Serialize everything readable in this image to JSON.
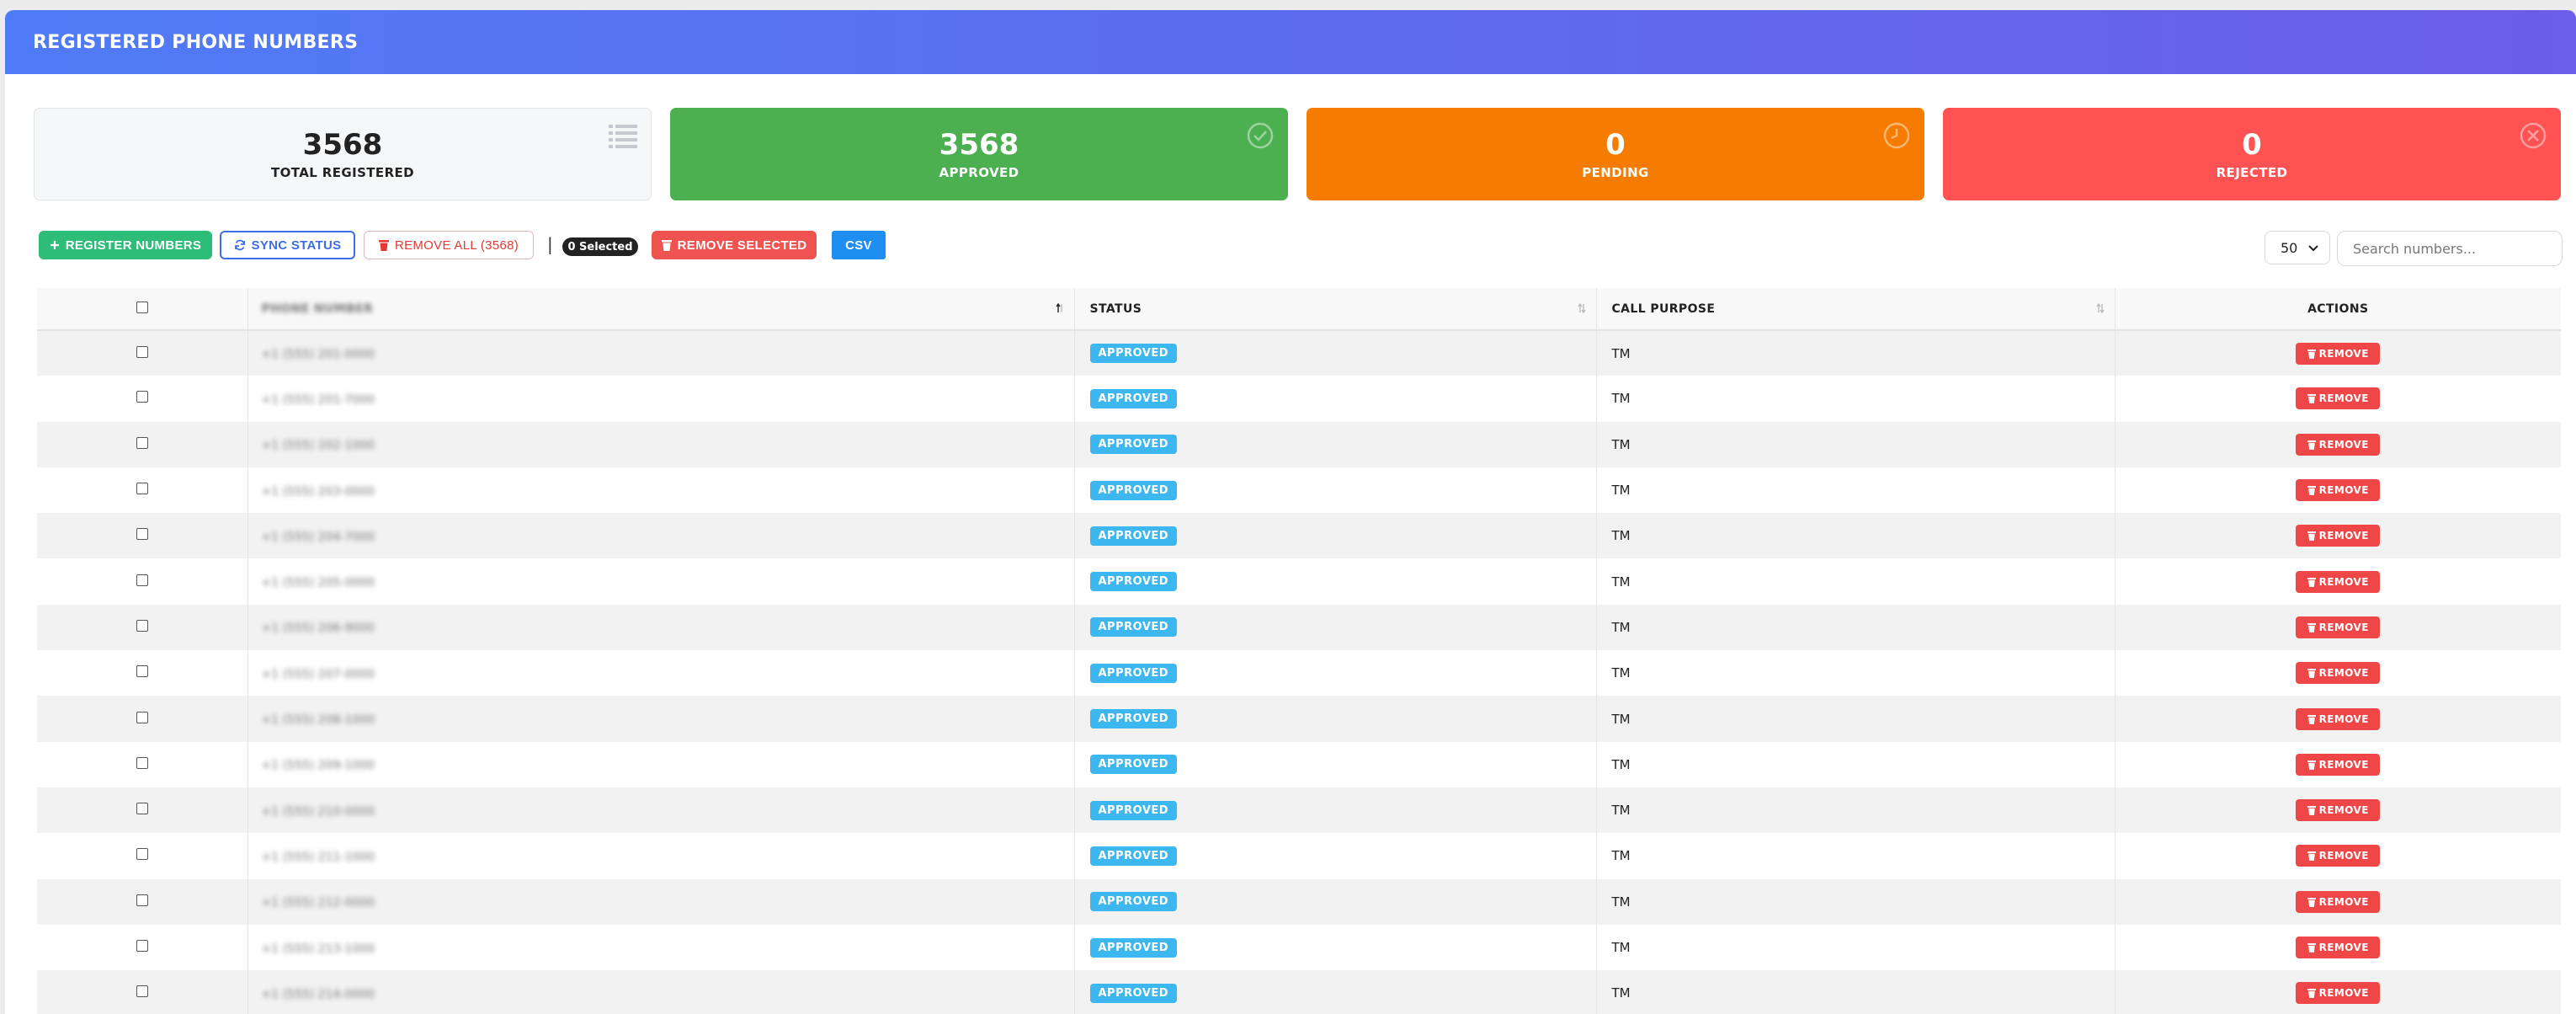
{
  "header": {
    "title": "REGISTERED PHONE NUMBERS"
  },
  "stats": {
    "total": {
      "value": "3568",
      "label": "TOTAL REGISTERED"
    },
    "approved": {
      "value": "3568",
      "label": "APPROVED"
    },
    "pending": {
      "value": "0",
      "label": "PENDING"
    },
    "rejected": {
      "value": "0",
      "label": "REJECTED"
    }
  },
  "toolbar": {
    "register_label": "REGISTER NUMBERS",
    "sync_label": "SYNC STATUS",
    "remove_all_label": "REMOVE ALL (3568)",
    "separator": "|",
    "selected_badge": "0 Selected",
    "remove_selected_label": "REMOVE SELECTED",
    "csv_label": "CSV",
    "page_size": "50",
    "search_placeholder": "Search numbers..."
  },
  "table": {
    "columns": {
      "phone": "PHONE NUMBER",
      "status": "STATUS",
      "purpose": "CALL PURPOSE",
      "actions": "ACTIONS"
    },
    "rows": [
      {
        "phone": "+1 (555) 201-0000",
        "status": "APPROVED",
        "purpose": "TM",
        "action": "REMOVE"
      },
      {
        "phone": "+1 (555) 201-7000",
        "status": "APPROVED",
        "purpose": "TM",
        "action": "REMOVE"
      },
      {
        "phone": "+1 (555) 202-1000",
        "status": "APPROVED",
        "purpose": "TM",
        "action": "REMOVE"
      },
      {
        "phone": "+1 (555) 203-0000",
        "status": "APPROVED",
        "purpose": "TM",
        "action": "REMOVE"
      },
      {
        "phone": "+1 (555) 204-7000",
        "status": "APPROVED",
        "purpose": "TM",
        "action": "REMOVE"
      },
      {
        "phone": "+1 (555) 205-0000",
        "status": "APPROVED",
        "purpose": "TM",
        "action": "REMOVE"
      },
      {
        "phone": "+1 (555) 206-9000",
        "status": "APPROVED",
        "purpose": "TM",
        "action": "REMOVE"
      },
      {
        "phone": "+1 (555) 207-0000",
        "status": "APPROVED",
        "purpose": "TM",
        "action": "REMOVE"
      },
      {
        "phone": "+1 (555) 208-1000",
        "status": "APPROVED",
        "purpose": "TM",
        "action": "REMOVE"
      },
      {
        "phone": "+1 (555) 209-1000",
        "status": "APPROVED",
        "purpose": "TM",
        "action": "REMOVE"
      },
      {
        "phone": "+1 (555) 210-0000",
        "status": "APPROVED",
        "purpose": "TM",
        "action": "REMOVE"
      },
      {
        "phone": "+1 (555) 211-1000",
        "status": "APPROVED",
        "purpose": "TM",
        "action": "REMOVE"
      },
      {
        "phone": "+1 (555) 212-0000",
        "status": "APPROVED",
        "purpose": "TM",
        "action": "REMOVE"
      },
      {
        "phone": "+1 (555) 213-1000",
        "status": "APPROVED",
        "purpose": "TM",
        "action": "REMOVE"
      },
      {
        "phone": "+1 (555) 214-0000",
        "status": "APPROVED",
        "purpose": "TM",
        "action": "REMOVE"
      }
    ]
  },
  "colors": {
    "header_start": "#4f7bf7",
    "header_end": "#6b5ee8",
    "approved": "#4caf50",
    "pending": "#f57c00",
    "rejected": "#ff5252",
    "status_pill": "#3db7f0",
    "remove_btn": "#ef4747"
  },
  "icons": {
    "total": "list-icon",
    "approved": "check-circle-icon",
    "pending": "clock-icon",
    "rejected": "x-circle-icon",
    "register": "plus-icon",
    "sync": "refresh-icon",
    "remove": "trash-icon",
    "page_size": "chevron-down-icon",
    "sort": "sort-icon"
  }
}
